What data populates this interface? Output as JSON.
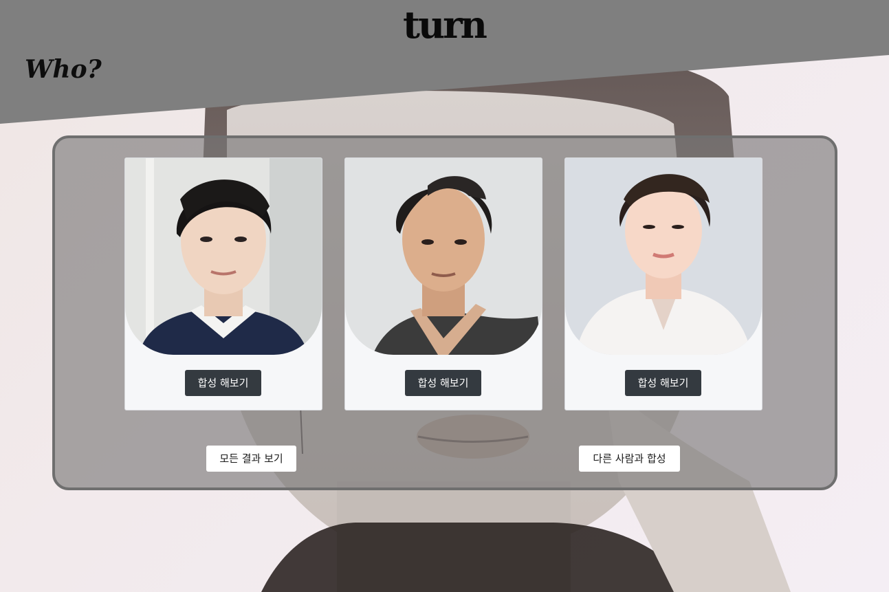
{
  "header": {
    "logo_text": "turn",
    "who_text": "Who?"
  },
  "cards": [
    {
      "photo_name": "person-photo-1",
      "button_label": "합성 해보기"
    },
    {
      "photo_name": "person-photo-2",
      "button_label": "합성 해보기"
    },
    {
      "photo_name": "person-photo-3",
      "button_label": "합성 해보기"
    }
  ],
  "actions": {
    "view_all_label": "모든 결과 보기",
    "other_person_label": "다른 사람과 합성"
  },
  "colors": {
    "header_band": "#7f7f7f",
    "panel_border": "#6f6f6f",
    "dark_button": "#343a40",
    "card_bg": "#f6f7f9"
  }
}
